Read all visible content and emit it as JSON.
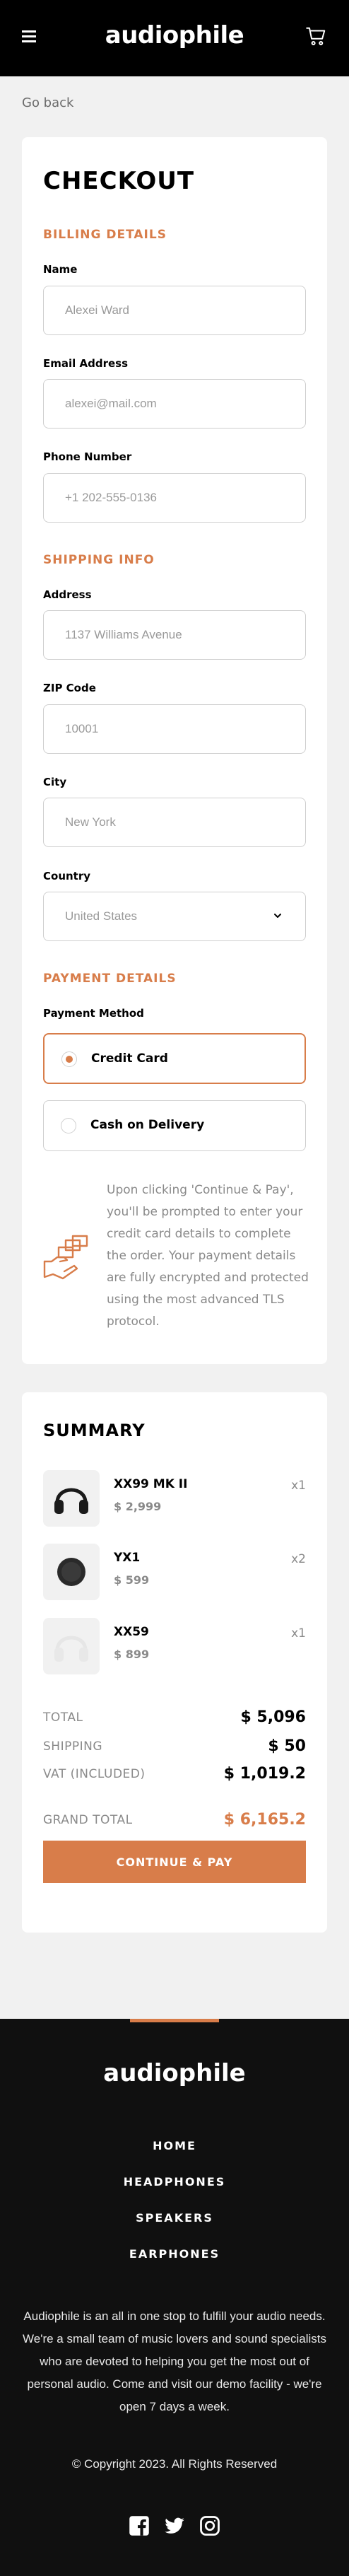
{
  "header": {
    "logo": "audiophile",
    "menu_icon": "hamburger-icon",
    "cart_icon": "cart-icon"
  },
  "go_back": "Go back",
  "checkout": {
    "title": "CHECKOUT",
    "billing": {
      "heading": "BILLING DETAILS",
      "name": {
        "label": "Name",
        "placeholder": "Alexei Ward"
      },
      "email": {
        "label": "Email Address",
        "placeholder": "alexei@mail.com"
      },
      "phone": {
        "label": "Phone Number",
        "placeholder": "+1 202-555-0136"
      }
    },
    "shipping": {
      "heading": "SHIPPING INFO",
      "address": {
        "label": "Address",
        "placeholder": "1137 Williams Avenue"
      },
      "zip": {
        "label": "ZIP Code",
        "placeholder": "10001"
      },
      "city": {
        "label": "City",
        "placeholder": "New York"
      },
      "country": {
        "label": "Country",
        "value": "United States"
      }
    },
    "payment": {
      "heading": "PAYMENT DETAILS",
      "method_label": "Payment Method",
      "options": [
        {
          "label": "Credit Card",
          "selected": true
        },
        {
          "label": "Cash on Delivery",
          "selected": false
        }
      ],
      "note": "Upon clicking 'Continue & Pay', you'll be prompted to enter your credit card details to complete the order. Your payment details are fully encrypted and protected using the most advanced TLS protocol."
    }
  },
  "summary": {
    "title": "SUMMARY",
    "items": [
      {
        "name": "XX99 MK II",
        "price": "$ 2,999",
        "qty": "x1"
      },
      {
        "name": "YX1",
        "price": "$ 599",
        "qty": "x2"
      },
      {
        "name": "XX59",
        "price": "$ 899",
        "qty": "x1"
      }
    ],
    "totals": [
      {
        "label": "TOTAL",
        "value": "$ 5,096"
      },
      {
        "label": "SHIPPING",
        "value": "$ 50"
      },
      {
        "label": "VAT (INCLUDED)",
        "value": "$ 1,019.2"
      }
    ],
    "grand_total": {
      "label": "GRAND TOTAL",
      "value": "$ 6,165.2"
    },
    "button": "CONTINUE & PAY"
  },
  "footer": {
    "logo": "audiophile",
    "nav": [
      "HOME",
      "HEADPHONES",
      "SPEAKERS",
      "EARPHONES"
    ],
    "description": "Audiophile is an all in one stop to fulfill your audio needs. We're a small team of music lovers and sound specialists who are devoted to helping you get the most out of personal audio. Come and visit our demo facility - we're open 7 days a week.",
    "copyright": "© Copyright 2023. All Rights Reserved",
    "social": [
      "facebook-icon",
      "twitter-icon",
      "instagram-icon"
    ]
  },
  "colors": {
    "accent": "#d87d4a",
    "dark": "#101010",
    "background": "#f1f1f1"
  }
}
